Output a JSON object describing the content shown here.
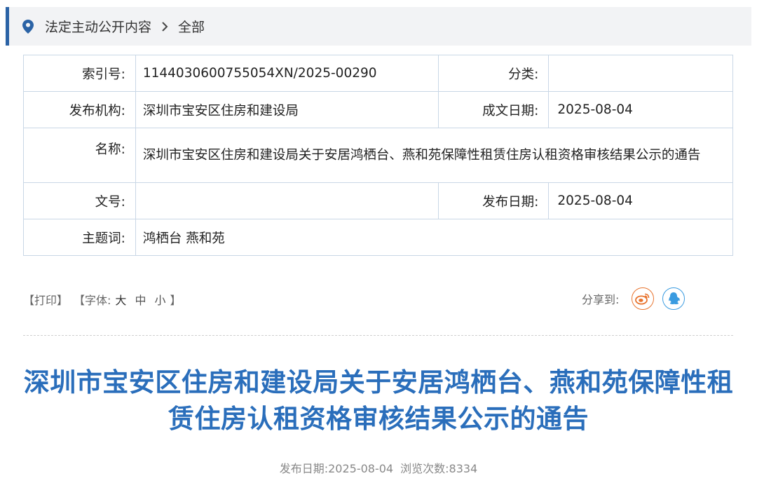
{
  "breadcrumb": {
    "section": "法定主动公开内容",
    "separator": "›",
    "current": "全部"
  },
  "meta": {
    "index_label": "索引号:",
    "index_value": "1144030600755054XN/2025-00290",
    "category_label": "分类:",
    "category_value": "",
    "publisher_label": "发布机构:",
    "publisher_value": "深圳市宝安区住房和建设局",
    "created_label": "成文日期:",
    "created_value": "2025-08-04",
    "name_label": "名称:",
    "name_value": "深圳市宝安区住房和建设局关于安居鸿栖台、燕和苑保障性租赁住房认租资格审核结果公示的通告",
    "doc_no_label": "文号:",
    "doc_no_value": "",
    "pub_date_label": "发布日期:",
    "pub_date_value": "2025-08-04",
    "keywords_label": "主题词:",
    "keywords_value": "鸿栖台 燕和苑"
  },
  "tools": {
    "print": "【打印】",
    "font_open": "【字体:",
    "font_large": "大",
    "font_medium": "中",
    "font_small": "小",
    "font_close": "】",
    "share_label": "分享到:"
  },
  "article": {
    "title": "深圳市宝安区住房和建设局关于安居鸿栖台、燕和苑保障性租赁住房认租资格审核结果公示的通告",
    "pub_date_text": "发布日期:2025-08-04",
    "views_text": "浏览次数:8334"
  },
  "colors": {
    "accent": "#2b63a6",
    "title": "#2a6ebb",
    "weibo": "#e8742f",
    "qq": "#3a9be0"
  },
  "icons": {
    "location": "location-pin-icon",
    "chevron": "chevron-right-icon",
    "weibo": "weibo-icon",
    "qq": "qq-icon"
  }
}
